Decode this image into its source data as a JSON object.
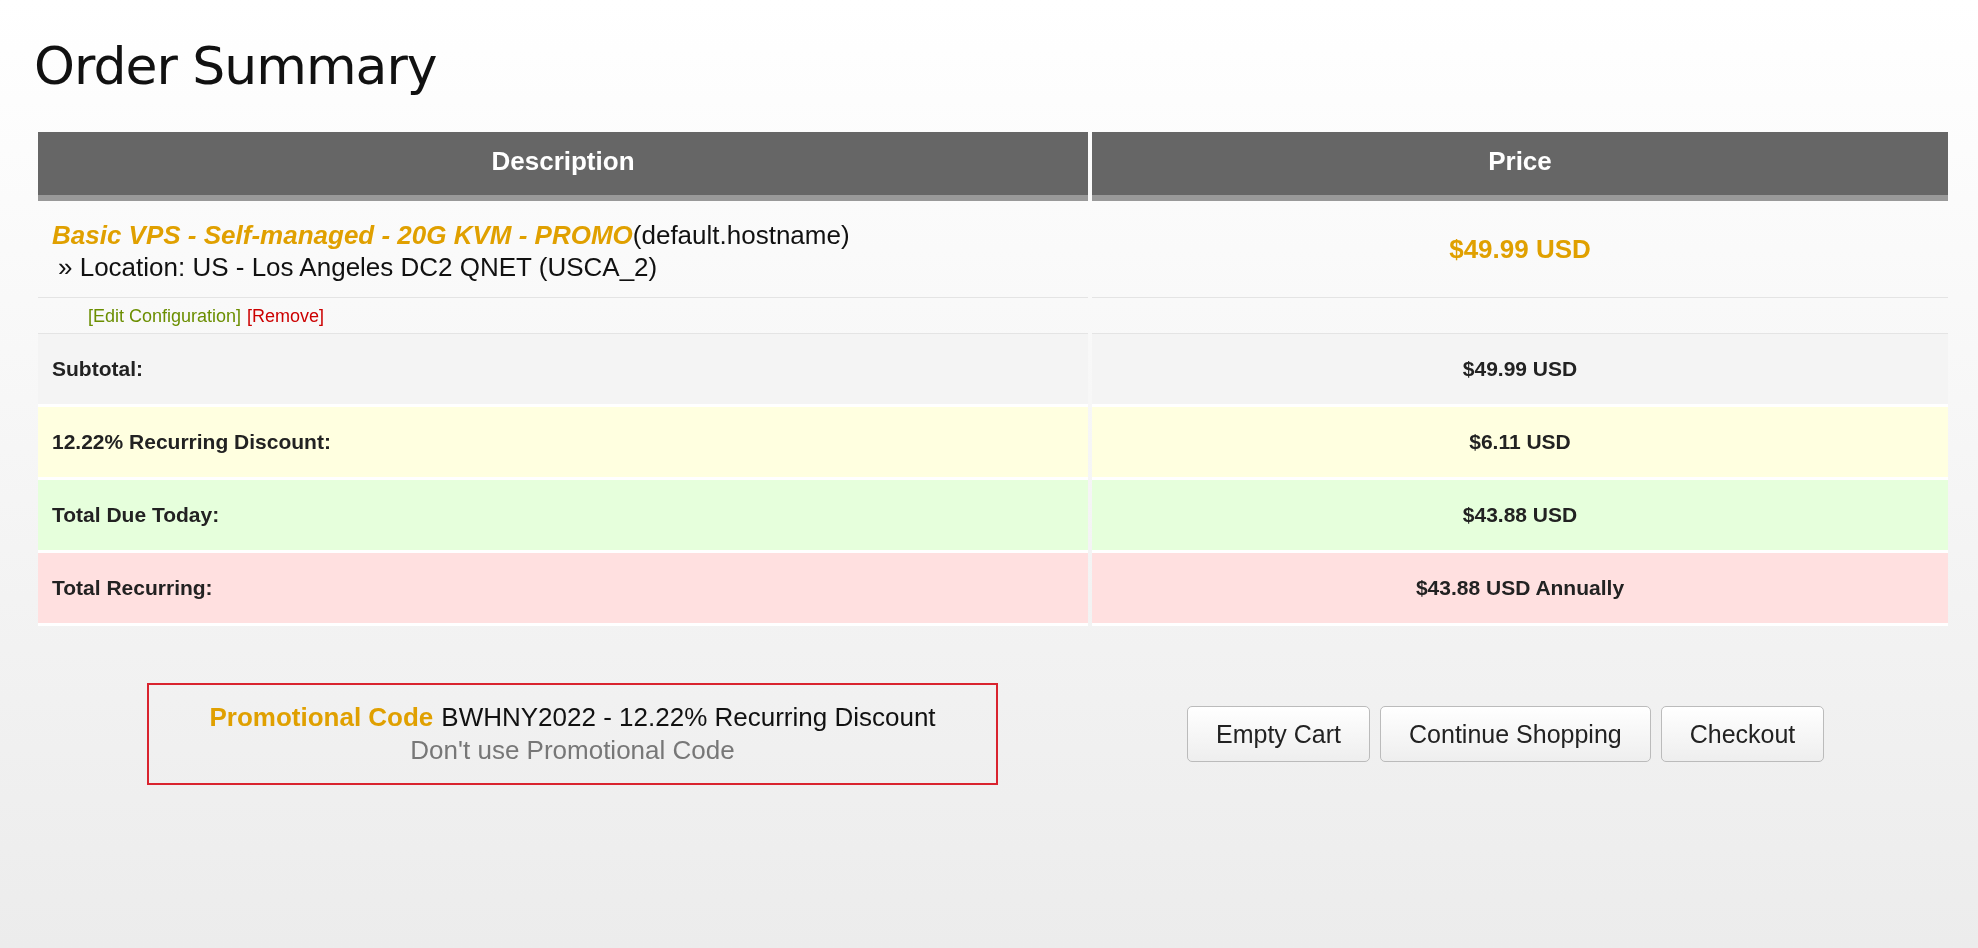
{
  "title": "Order Summary",
  "table": {
    "columns": [
      "Description",
      "Price"
    ],
    "item": {
      "name": "Basic VPS - Self-managed - 20G KVM - PROMO",
      "hostname": "(default.hostname)",
      "location": "» Location: US - Los Angeles DC2 QNET (USCA_2)",
      "price": "$49.99 USD",
      "links": [
        {
          "label": "[Edit Configuration]",
          "kind": "edit"
        },
        {
          "label": "[Remove]",
          "kind": "remove"
        }
      ]
    },
    "summary": [
      {
        "kind": "subtotal",
        "label": "Subtotal:",
        "value": "$49.99 USD"
      },
      {
        "kind": "discount",
        "label": "12.22% Recurring Discount:",
        "value": "$6.11 USD"
      },
      {
        "kind": "due",
        "label": "Total Due Today:",
        "value": "$43.88 USD"
      },
      {
        "kind": "recurring",
        "label": "Total Recurring:",
        "value": "$43.88 USD Annually"
      }
    ]
  },
  "promo": {
    "label": "Promotional Code",
    "code": "BWHNY2022 - 12.22% Recurring Discount",
    "remove_link": "Don't use Promotional Code"
  },
  "buttons": [
    "Empty Cart",
    "Continue Shopping",
    "Checkout"
  ]
}
